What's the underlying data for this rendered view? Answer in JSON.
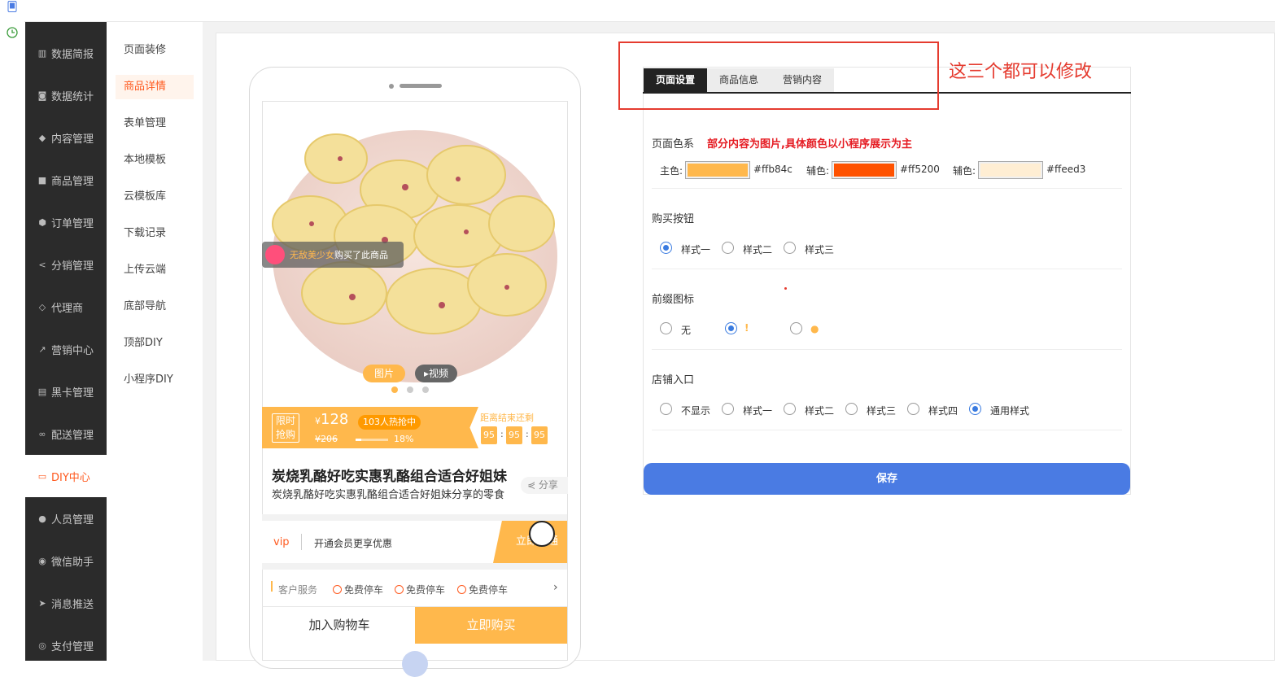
{
  "nav": {
    "items": [
      {
        "label": "数据简报",
        "icon": "bar-chart-icon"
      },
      {
        "label": "数据统计",
        "icon": "camera-icon"
      },
      {
        "label": "内容管理",
        "icon": "tag-icon"
      },
      {
        "label": "商品管理",
        "icon": "bag-icon"
      },
      {
        "label": "订单管理",
        "icon": "cube-icon"
      },
      {
        "label": "分销管理",
        "icon": "share-icon"
      },
      {
        "label": "代理商",
        "icon": "diamond-icon"
      },
      {
        "label": "营销中心",
        "icon": "line-chart-icon"
      },
      {
        "label": "黑卡管理",
        "icon": "card-icon"
      },
      {
        "label": "配送管理",
        "icon": "bicycle-icon"
      },
      {
        "label": "DIY中心",
        "icon": "monitor-icon"
      },
      {
        "label": "人员管理",
        "icon": "users-icon"
      },
      {
        "label": "微信助手",
        "icon": "wechat-icon"
      },
      {
        "label": "消息推送",
        "icon": "send-icon"
      },
      {
        "label": "支付管理",
        "icon": "chat-icon"
      }
    ],
    "active": "DIY中心"
  },
  "subnav": {
    "items": [
      "页面装修",
      "商品详情",
      "表单管理",
      "本地模板",
      "云模板库",
      "下载记录",
      "上传云端",
      "底部导航",
      "顶部DIY",
      "小程序DIY"
    ],
    "active": "商品详情"
  },
  "preview": {
    "bought_name": "无敌美少女",
    "bought_text": "购买了此商品",
    "tab_pic": "图片",
    "tab_video": "视频",
    "sale_label_1": "限时",
    "sale_label_2": "抢购",
    "price_symbol": "¥",
    "price": "128",
    "hot": "103人热抢中",
    "old_price": "¥206",
    "progress_pct": "18%",
    "progress_value": 0.18,
    "countdown_title": "距离结束还剩",
    "countdown": [
      "95",
      "95",
      "95"
    ],
    "title": "炭烧乳酪好吃实惠乳酪组合适合好姐妹",
    "subtitle": "炭烧乳酪好吃实惠乳酪组合适合好姐妹分享的零食",
    "share": "分享",
    "vip_label": "vip",
    "vip_text": "开通会员更享优惠",
    "vip_btn": "立即开通",
    "service_main": "客户服务",
    "services": [
      "免费停车",
      "免费停车",
      "免费停车"
    ],
    "cart_btn": "加入购物车",
    "buy_btn": "立即购买"
  },
  "settings": {
    "tabs": [
      "页面设置",
      "商品信息",
      "营销内容"
    ],
    "active_tab": "页面设置",
    "annotation": "这三个都可以修改",
    "color_section": "页面色系",
    "color_note": "部分内容为图片,具体颜色以小程序展示为主",
    "colors": [
      {
        "label": "主色:",
        "hex": "#ffb84c"
      },
      {
        "label": "辅色:",
        "hex": "#ff5200"
      },
      {
        "label": "辅色:",
        "hex": "#ffeed3"
      }
    ],
    "buy_button_section": "购买按钮",
    "buy_button_options": [
      "样式一",
      "样式二",
      "样式三"
    ],
    "buy_button_selected": "样式一",
    "prefix_section": "前缀图标",
    "prefix_options": [
      "无",
      "!",
      "●"
    ],
    "prefix_selected": "!",
    "shop_section": "店铺入口",
    "shop_options": [
      "不显示",
      "样式一",
      "样式二",
      "样式三",
      "样式四",
      "通用样式"
    ],
    "shop_selected": "通用样式",
    "save": "保存"
  }
}
